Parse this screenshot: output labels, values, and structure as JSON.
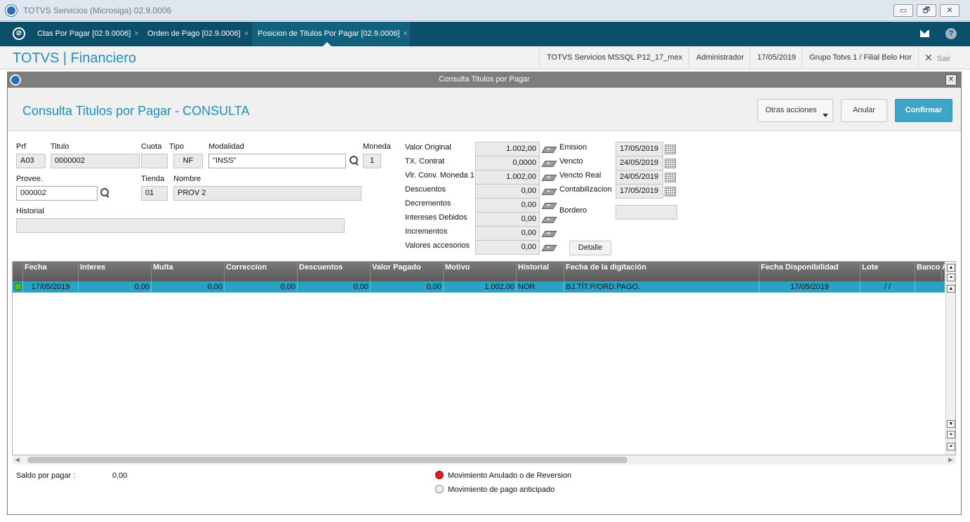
{
  "window": {
    "title": "TOTVS Servicios (Microsiga) 02.9.0006",
    "minimize_glyph": "▭",
    "restore_glyph": "🗗",
    "close_glyph": "✕",
    "logo_icon": "totvs-logo-icon"
  },
  "tabs": {
    "home_glyph": "⊘",
    "close_glyph": "×",
    "items": [
      {
        "label": "Ctas Por Pagar [02.9.0006]"
      },
      {
        "label": "Orden de Pago [02.9.0006]"
      },
      {
        "label": "Posicion de Titulos Por Pagar [02.9.0006]"
      }
    ],
    "help_glyph": "?"
  },
  "header": {
    "brand": "TOTVS | Financiero",
    "environment": "TOTVS Servicios MSSQL P12_17_mex",
    "user": "Administrador",
    "date": "17/05/2019",
    "branch": "Grupo Totvs 1 / Filial Belo Hor",
    "exit_glyph": "✕",
    "exit_label": "Sair"
  },
  "dialog": {
    "bar_title": "Consulta Titulos por Pagar",
    "close_glyph": "✕",
    "title": "Consulta Titulos por Pagar - CONSULTA",
    "buttons": {
      "other_actions": "Otras acciones",
      "cancel": "Anular",
      "confirm": "Confirmar"
    }
  },
  "form": {
    "prf": {
      "label": "Prf",
      "value": "A03"
    },
    "titulo": {
      "label": "Titulo",
      "value": "0000002"
    },
    "cuota": {
      "label": "Cuota",
      "value": ""
    },
    "tipo": {
      "label": "Tipo",
      "value": "NF"
    },
    "modalidad": {
      "label": "Modalidad",
      "value": "\"INSS\""
    },
    "moneda": {
      "label": "Moneda",
      "value": "1"
    },
    "provee": {
      "label": "Provee.",
      "value": "000002"
    },
    "tienda": {
      "label": "Tienda",
      "value": "01"
    },
    "nombre": {
      "label": "Nombre",
      "value": "PROV 2"
    },
    "historial": {
      "label": "Historial",
      "value": ""
    },
    "amounts": [
      {
        "label": "Valor Original",
        "value": "1.002,00"
      },
      {
        "label": "TX. Contrat",
        "value": "0,0000"
      },
      {
        "label": "Vlr. Conv. Moneda 1",
        "value": "1.002,00"
      },
      {
        "label": "Descuentos",
        "value": "0,00"
      },
      {
        "label": "Decrementos",
        "value": "0,00"
      },
      {
        "label": "Intereses Debidos",
        "value": "0,00"
      },
      {
        "label": "Incrementos",
        "value": "0,00"
      },
      {
        "label": "Valores accesorios",
        "value": "0,00"
      }
    ],
    "dates": [
      {
        "label": "Emision",
        "value": "17/05/2019"
      },
      {
        "label": "Vencto",
        "value": "24/05/2019"
      },
      {
        "label": "Vencto Real",
        "value": "24/05/2019"
      },
      {
        "label": "Contabilizacion",
        "value": "17/05/2019"
      }
    ],
    "bordero": {
      "label": "Bordero",
      "value": ""
    },
    "detail_button": "Detalle"
  },
  "grid": {
    "columns": [
      "Fecha",
      "Interes",
      "Multa",
      "Correccion",
      "Descuentos",
      "Valor Pagado",
      "Motivo",
      "Historial",
      "Fecha de la digitación",
      "Fecha Disponibilidad",
      "Lote",
      "Banco",
      "A"
    ],
    "rows": [
      {
        "status_color": "#4fc21f",
        "fecha": "17/05/2019",
        "interes": "0,00",
        "multa": "0,00",
        "correccion": "0,00",
        "descuentos": "0,00",
        "valor_pagado": "0,00",
        "motivo": "1.002,00",
        "historial": "NOR",
        "fecha_digitacion": "BJ.TÍT.P/ORD.PAGO.",
        "fecha_disponibilidad": "17/05/2019",
        "lote": "/ /",
        "banco": ""
      }
    ],
    "scroll_up": "▲",
    "scroll_top": "⏶",
    "scroll_down": "▼",
    "scroll_bottom": "⏷"
  },
  "footer": {
    "saldo_label": "Saldo por pagar :",
    "saldo_value": "0,00",
    "legend": [
      {
        "label": "Movimiento Anulado o de Reversion",
        "color": "#e02020"
      },
      {
        "label": "Movimiento de pago anticipado",
        "color": "#f0f0f0"
      }
    ]
  }
}
